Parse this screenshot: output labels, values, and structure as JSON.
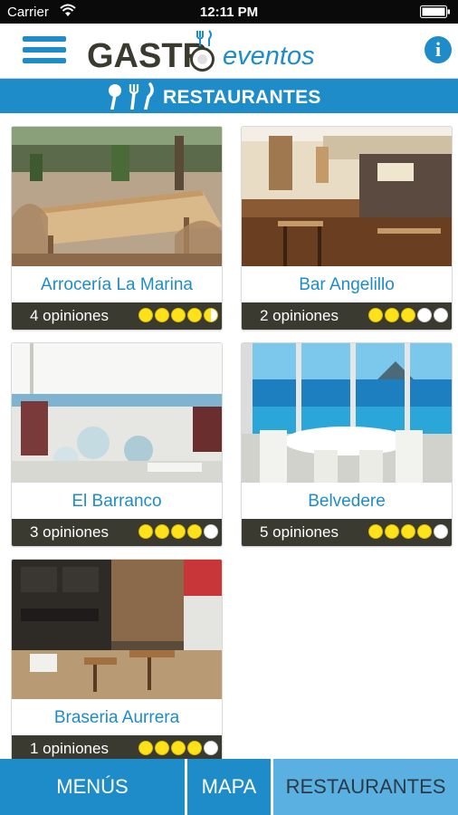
{
  "status_bar": {
    "carrier": "Carrier",
    "time": "12:11 PM"
  },
  "header": {
    "logo_gastro": "GASTR",
    "logo_eventos": "eventos",
    "info_label": "i"
  },
  "section": {
    "title": "RESTAURANTES",
    "icon": "cutlery-icon"
  },
  "restaurants": [
    {
      "name": "Arrocería La Marina",
      "opinions": "4 opiniones",
      "rating": 4.5
    },
    {
      "name": "Bar Angelillo",
      "opinions": "2 opiniones",
      "rating": 3
    },
    {
      "name": "El Barranco",
      "opinions": "3 opiniones",
      "rating": 4
    },
    {
      "name": "Belvedere",
      "opinions": "5 opiniones",
      "rating": 4
    },
    {
      "name": "Braseria Aurrera",
      "opinions": "1 opiniones",
      "rating": 4
    }
  ],
  "tabs": [
    {
      "label": "MENÚS"
    },
    {
      "label": "MAPA"
    },
    {
      "label": "RESTAURANTES"
    }
  ],
  "colors": {
    "accent": "#1e8cc8",
    "tab_active": "#5ab0e0",
    "meta_bar": "#3a3a30",
    "star": "#ffe21a"
  }
}
